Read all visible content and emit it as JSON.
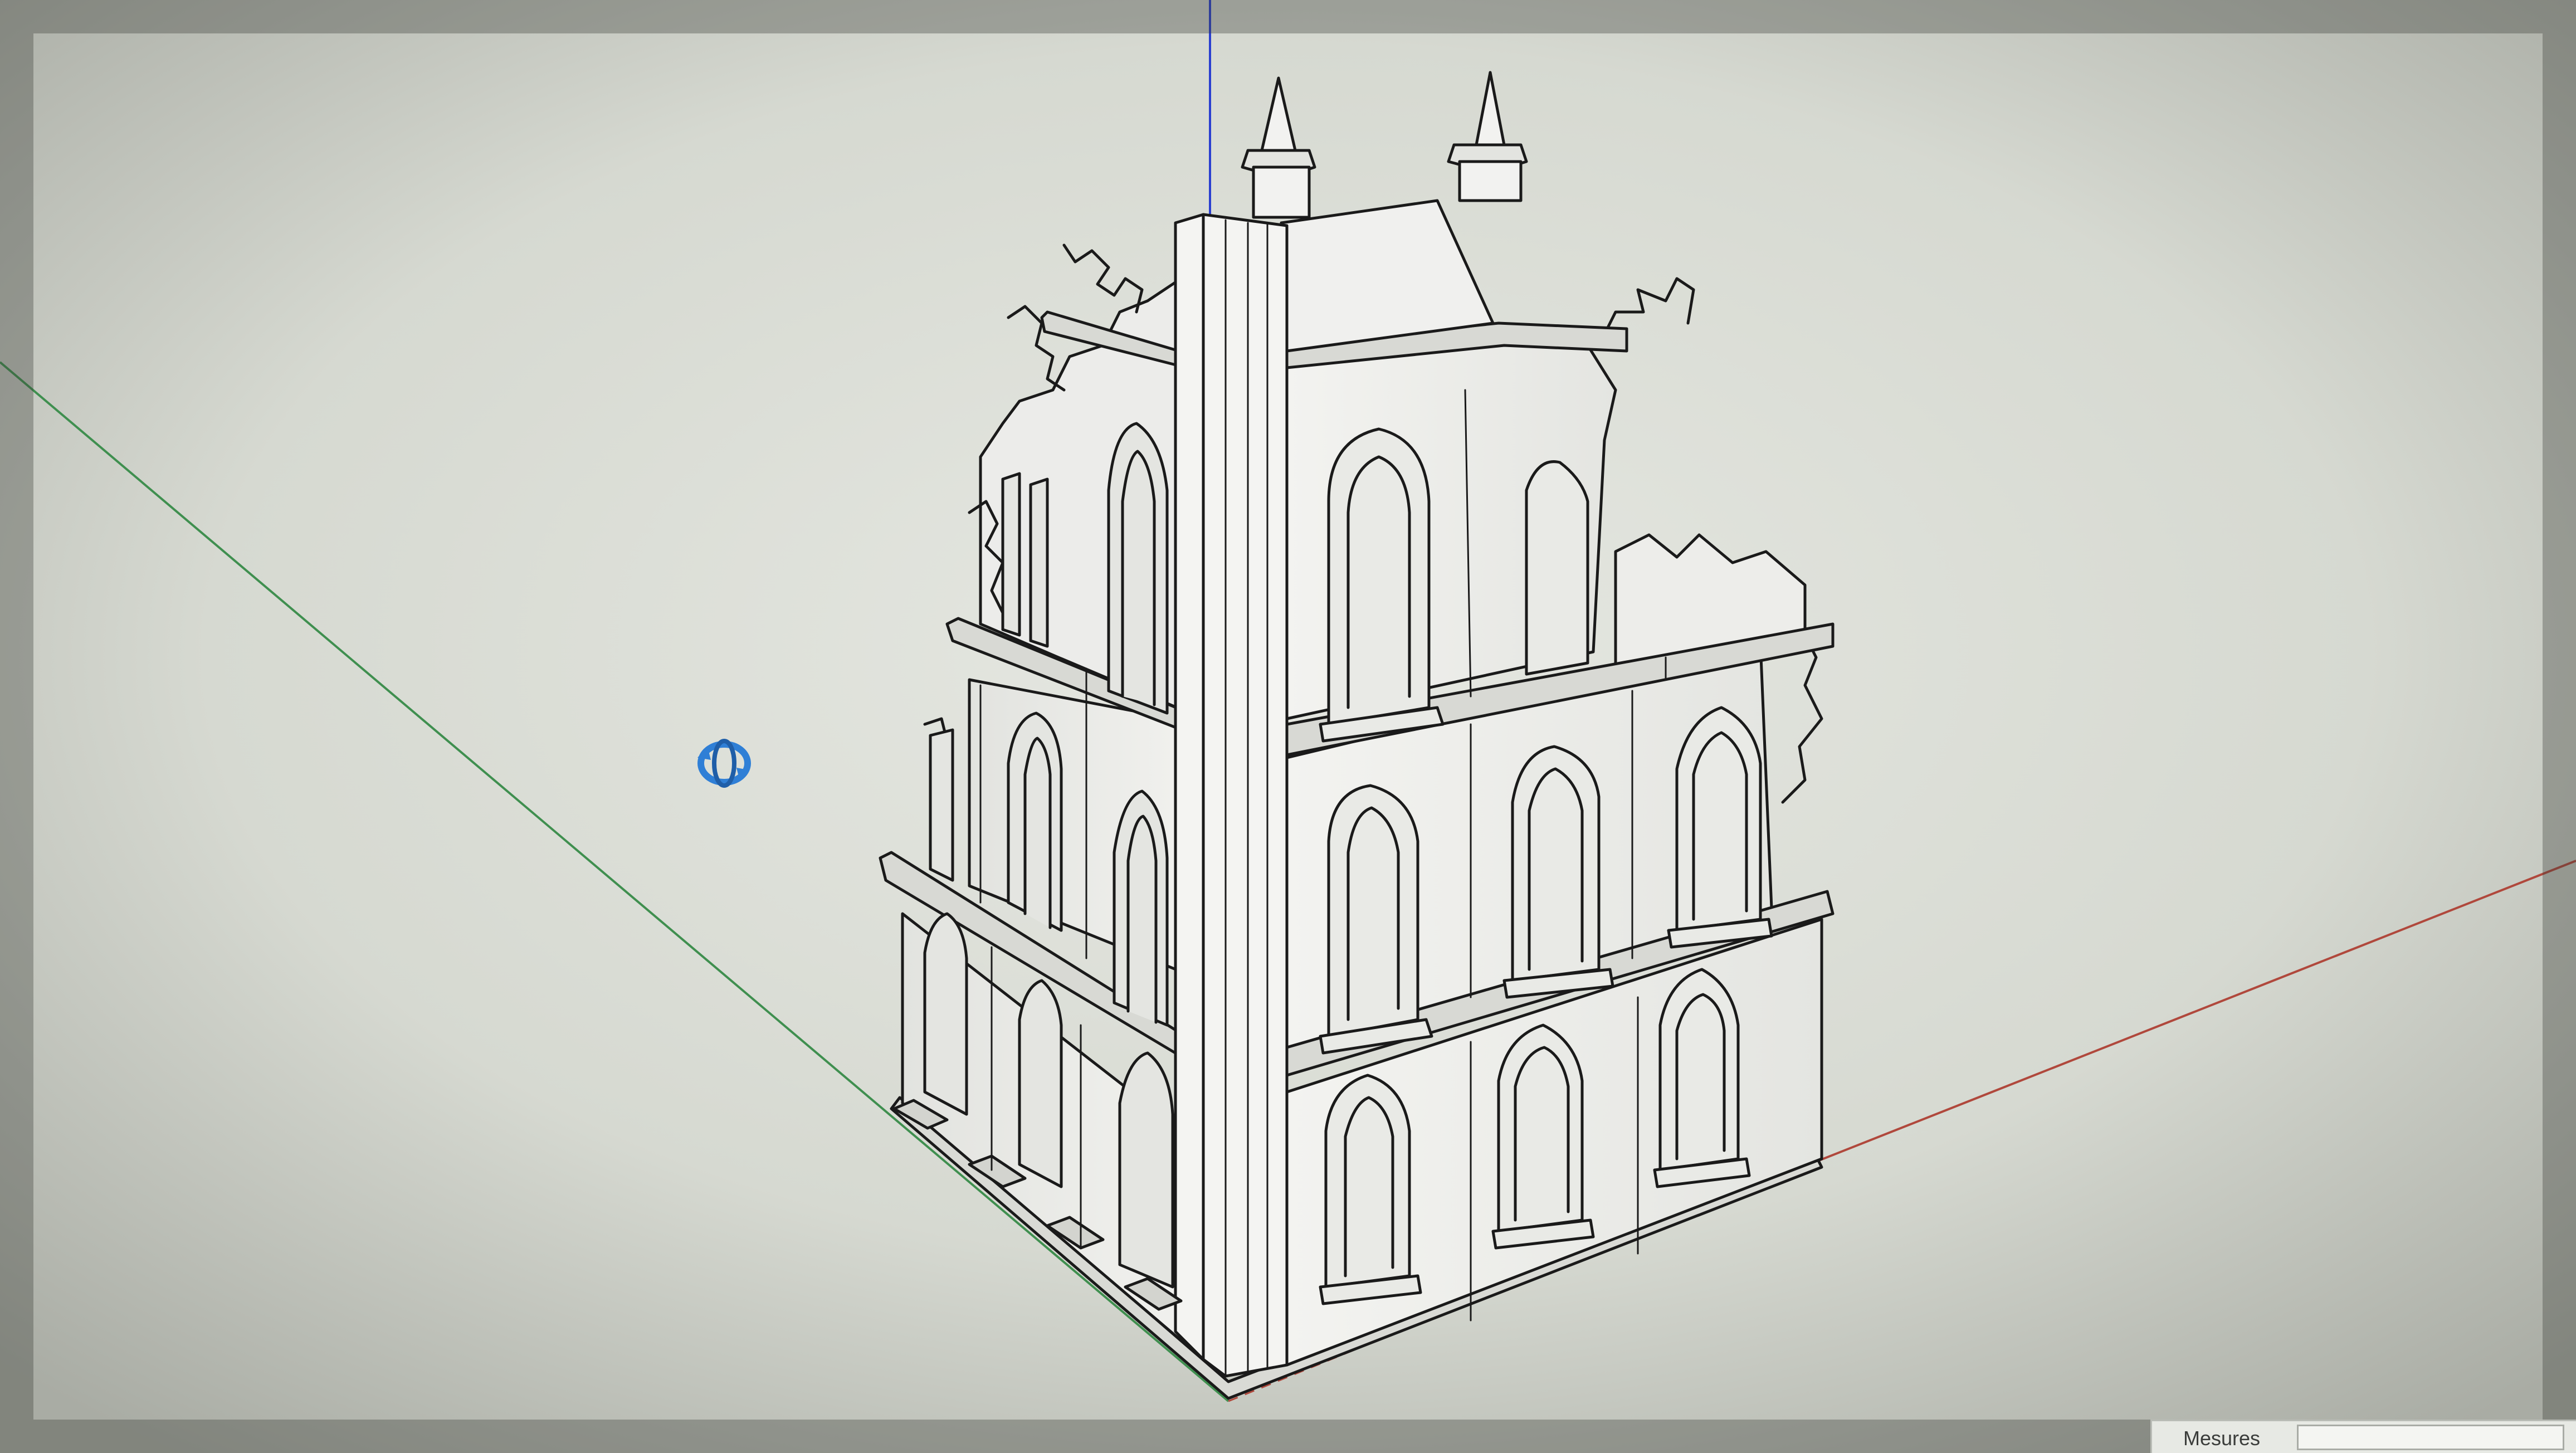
{
  "app": {
    "tool_icon": "orbit-icon",
    "status_bar": {
      "measurements_label": "Mesures",
      "measurements_value": ""
    }
  },
  "colors": {
    "canvas": "#d9dcd5",
    "model_face": "#ecedea",
    "model_edge": "#1a1a1a",
    "axis_blue": "#2a3fd0",
    "axis_green": "#3f8f4f",
    "axis_red": "#b0483c",
    "orbit_icon": "#2f7fd6"
  }
}
